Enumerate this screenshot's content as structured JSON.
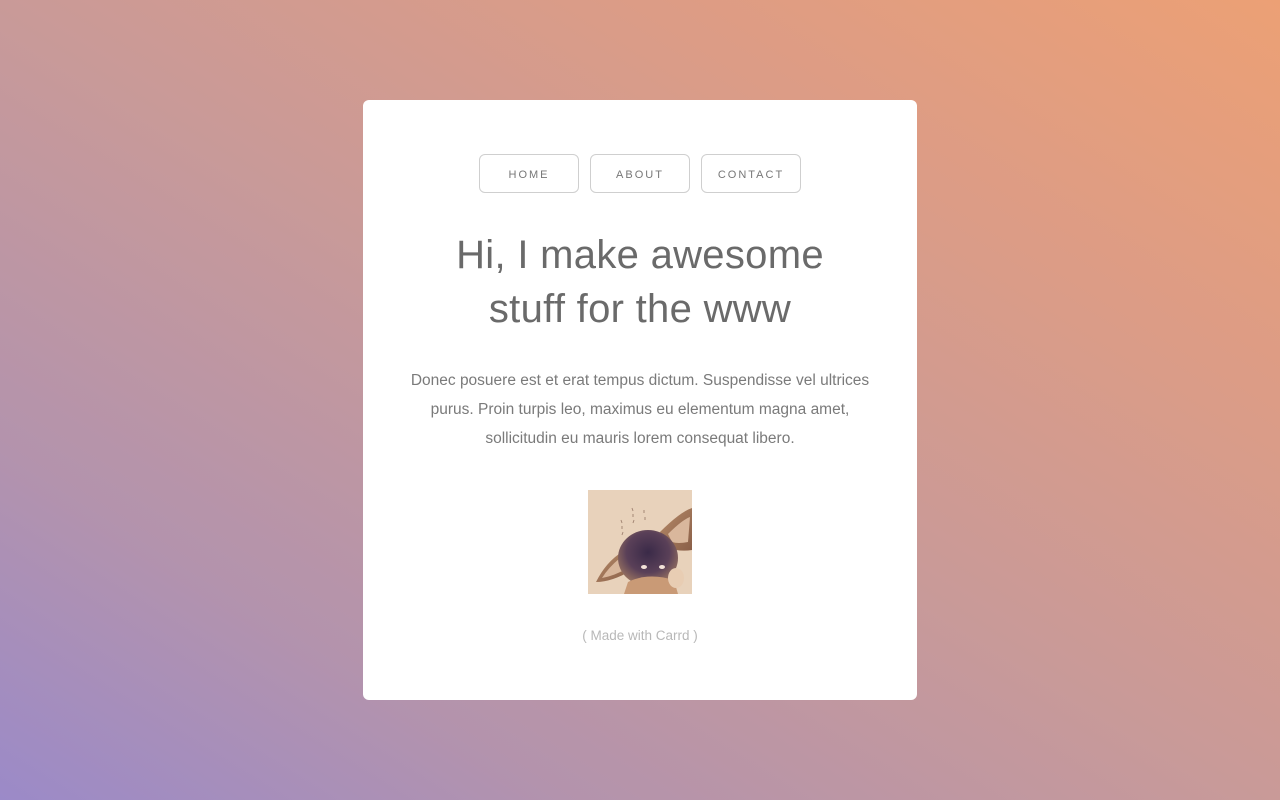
{
  "nav": {
    "items": [
      {
        "label": "HOME"
      },
      {
        "label": "ABOUT"
      },
      {
        "label": "CONTACT"
      }
    ]
  },
  "hero": {
    "headline_line1": "Hi, I make awesome",
    "headline_line2": "stuff for the www",
    "body_line1": "Donec posuere est et erat tempus dictum. Suspendisse vel ultrices",
    "body_line2": "purus. Proin turpis leo, maximus eu elementum magna amet,",
    "body_line3": "sollicitudin eu mauris lorem consequat libero."
  },
  "footer": {
    "credit_open": "( ",
    "credit_link": "Made with Carrd",
    "credit_close": " )"
  },
  "colors": {
    "background_start": "#9b8ac8",
    "background_end": "#eca075",
    "card": "#ffffff",
    "text": "#6a6a6a"
  }
}
